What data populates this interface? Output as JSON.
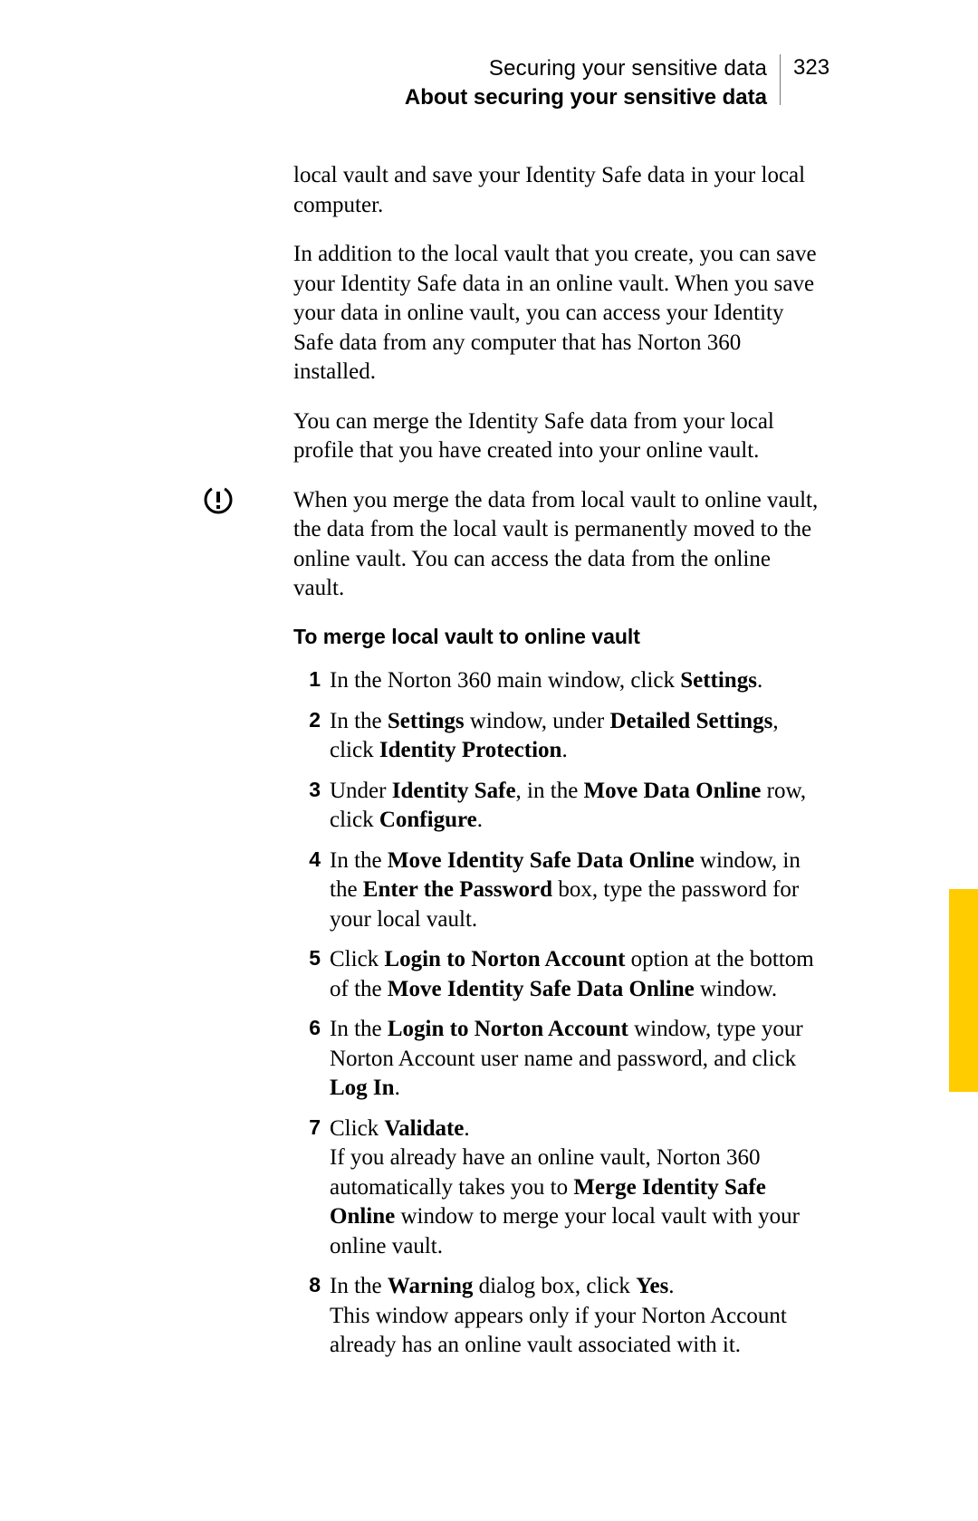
{
  "header": {
    "running_title": "Securing your sensitive data",
    "sub_title": "About securing your sensitive data",
    "page_number": "323"
  },
  "body": {
    "p1": "local vault and save your Identity Safe data in your local computer.",
    "p2": "In addition to the local vault that you create, you can save your Identity Safe data in an online vault. When you save your data in online vault, you can access your Identity Safe data from any computer that has Norton 360 installed.",
    "p3": "You can merge the Identity Safe data from your local profile that you have created into your online vault.",
    "warn": "When you merge the data from local vault to online vault, the data from the local vault is permanently moved to the online vault. You can access the data from the online vault.",
    "task_heading": "To merge local vault to online vault"
  },
  "steps": {
    "s1_a": "In the Norton 360 main window, click ",
    "s1_b": "Settings",
    "s1_c": ".",
    "s2_a": "In the ",
    "s2_b": "Settings",
    "s2_c": " window, under ",
    "s2_d": "Detailed Settings",
    "s2_e": ", click ",
    "s2_f": "Identity Protection",
    "s2_g": ".",
    "s3_a": "Under ",
    "s3_b": "Identity Safe",
    "s3_c": ", in the ",
    "s3_d": "Move Data Online",
    "s3_e": " row, click ",
    "s3_f": "Configure",
    "s3_g": ".",
    "s4_a": "In the ",
    "s4_b": "Move Identity Safe Data Online",
    "s4_c": " window, in the ",
    "s4_d": "Enter the Password",
    "s4_e": " box, type the password for your local vault.",
    "s5_a": "Click ",
    "s5_b": "Login to Norton Account",
    "s5_c": " option at the bottom of the ",
    "s5_d": "Move Identity Safe Data Online",
    "s5_e": " window.",
    "s6_a": "In the ",
    "s6_b": "Login to Norton Account",
    "s6_c": " window, type your Norton Account user name and password, and click ",
    "s6_d": "Log In",
    "s6_e": ".",
    "s7_a": "Click ",
    "s7_b": "Validate",
    "s7_c": ".",
    "s7_d": "If you already have an online vault, Norton 360 automatically takes you to ",
    "s7_e": "Merge Identity Safe Online",
    "s7_f": " window to merge your local vault with your online vault.",
    "s8_a": "In the ",
    "s8_b": "Warning",
    "s8_c": " dialog box, click ",
    "s8_d": "Yes",
    "s8_e": ".",
    "s8_f": "This window appears only if your Norton Account already has an online vault associated with it."
  },
  "icon": {
    "name": "warning-icon"
  }
}
